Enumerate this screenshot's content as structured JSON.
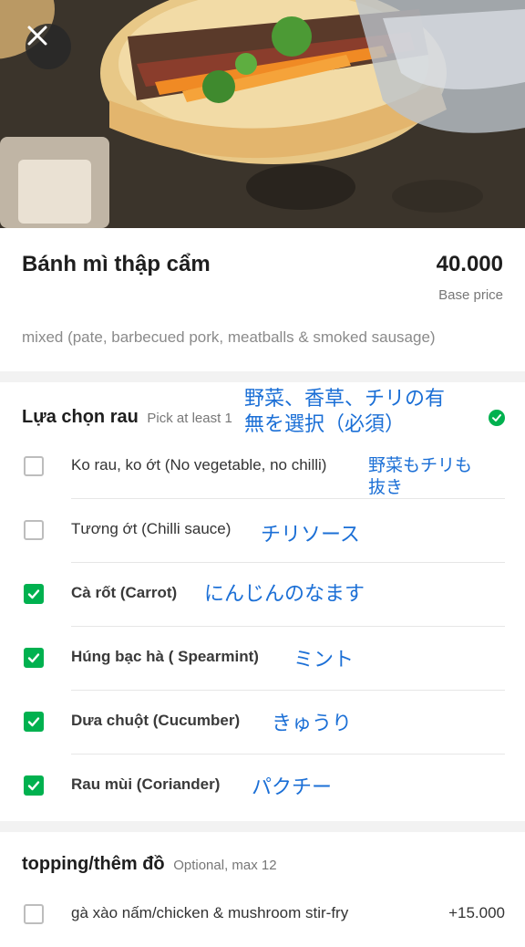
{
  "item": {
    "name": "Bánh mì thập cẩm",
    "price": "40.000",
    "price_caption": "Base price",
    "description": "mixed (pate, barbecued pork, meatballs & smoked sausage)"
  },
  "sections": [
    {
      "title": "Lựa chọn rau",
      "hint": "Pick at least 1",
      "note_line1": "野菜、香草、チリの有",
      "note_line2": "無を選択（必須）",
      "options": [
        {
          "label": "Ko rau, ko ớt (No vegetable, no chilli)",
          "checked": false,
          "note_line1": "野菜もチリも",
          "note_line2": "抜き"
        },
        {
          "label": "Tương ớt (Chilli sauce)",
          "checked": false,
          "note": "チリソース"
        },
        {
          "label": "Cà rốt (Carrot)",
          "checked": true,
          "note": "にんじんのなます"
        },
        {
          "label": "Húng bạc hà ( Spearmint)",
          "checked": true,
          "note": "ミント"
        },
        {
          "label": "Dưa chuột (Cucumber)",
          "checked": true,
          "note": "きゅうり"
        },
        {
          "label": "Rau mùi (Coriander)",
          "checked": true,
          "note": "パクチー"
        }
      ]
    },
    {
      "title": "topping/thêm đồ",
      "hint": "Optional, max 12",
      "options": [
        {
          "label": "gà xào nấm/chicken & mushroom stir-fry",
          "price": "+15.000",
          "checked": false
        }
      ]
    }
  ],
  "icons": {
    "close": "close-icon",
    "completed": "check-circle-icon",
    "checkbox_checked": "checkmark-icon"
  },
  "colors": {
    "accent_green": "#00b14f",
    "annotation_blue": "#1b6fd6"
  }
}
